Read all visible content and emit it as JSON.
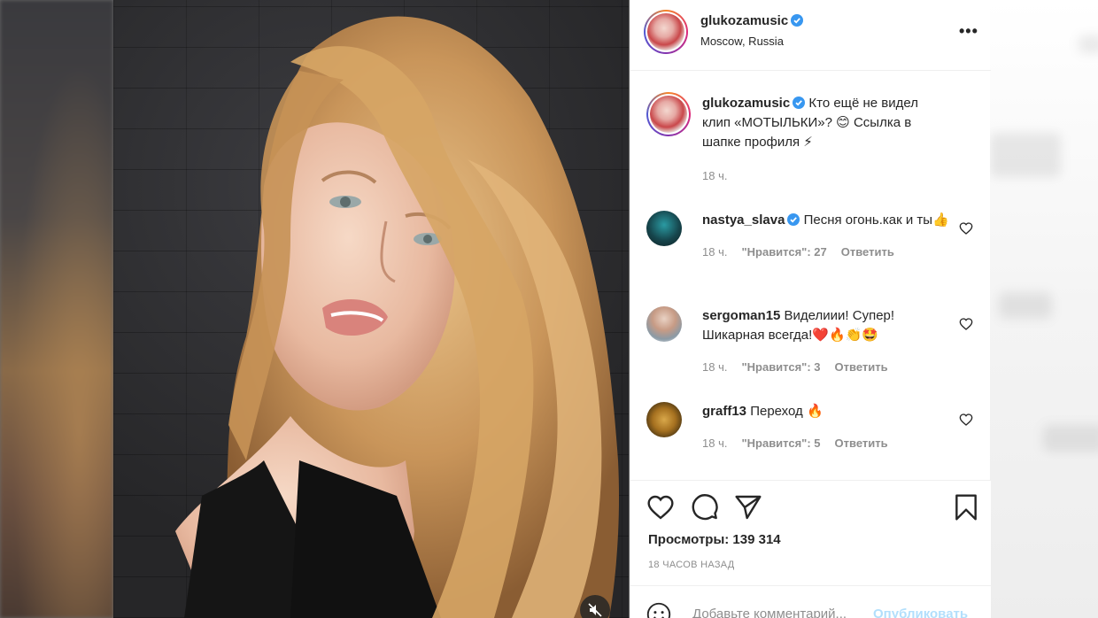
{
  "post": {
    "username": "glukozamusic",
    "location": "Moscow, Russia",
    "more_label": "•••",
    "caption": "Кто ещё не видел клип «МОТЫЛЬКИ»? 😊 Ссылка в шапке профиля ⚡",
    "caption_time": "18 ч."
  },
  "comments": [
    {
      "username": "nastya_slava",
      "text": "Песня огонь.как и ты👍",
      "time": "18 ч.",
      "likes": "\"Нравится\": 27",
      "reply": "Ответить",
      "verified": true
    },
    {
      "username": "sergoman15",
      "text": "Виделиии! Супер! Шикарная всегда!❤️🔥👏🤩",
      "time": "18 ч.",
      "likes": "\"Нравится\": 3",
      "reply": "Ответить",
      "verified": false
    },
    {
      "username": "graff13",
      "text": "Переход 🔥",
      "time": "18 ч.",
      "likes": "\"Нравится\": 5",
      "reply": "Ответить",
      "verified": false
    }
  ],
  "stats": {
    "views": "Просмотры: 139 314",
    "time_ago": "18 ЧАСОВ НАЗАД"
  },
  "composer": {
    "placeholder": "Добавьте комментарий...",
    "publish": "Опубликовать"
  },
  "icons": {
    "like": "heart-icon",
    "comment": "comment-icon",
    "share": "paper-plane-icon",
    "save": "bookmark-icon",
    "mute": "speaker-muted-icon",
    "emoji": "smiley-icon",
    "verified": "verified-badge-icon"
  },
  "colors": {
    "accent": "#0095f6",
    "verified": "#3897f0",
    "muted_text": "#8e8e8e",
    "publish_disabled": "#b2dffc"
  }
}
